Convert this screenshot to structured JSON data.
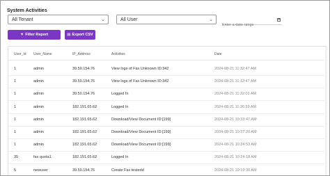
{
  "page": {
    "title": "System Activities"
  },
  "filters": {
    "tenant": "All Tenant",
    "user": "All User",
    "date_placeholder": "Enter a date range"
  },
  "buttons": {
    "filter_report": "Filter Report",
    "export_csv": "Export CSV"
  },
  "table": {
    "columns": [
      "User_Id",
      "User_Name",
      "IP_Address",
      "Activities",
      "Date"
    ],
    "rows": [
      [
        "1",
        "admin",
        "39.50.154.76",
        "View logs of Fax Unknown ID:342",
        "2024-08-21 11:32:47 AM"
      ],
      [
        "1",
        "admin",
        "39.50.154.76",
        "View logs of Fax Unknown ID:342",
        "2024-08-21 11:32:47 AM"
      ],
      [
        "1",
        "admin",
        "39.50.154.76",
        "Logged In",
        "2024-08-21 11:32:01 AM"
      ],
      [
        "1",
        "admin",
        "182.191.65.62",
        "Logged In",
        "2024-08-21 11:26:59 AM"
      ],
      [
        "1",
        "admin",
        "182.191.65.62",
        "Download/View Document ID:[199]",
        "2024-08-21 10:33:47 AM"
      ],
      [
        "1",
        "admin",
        "182.191.65.62",
        "Download/View Document ID:[199]",
        "2024-08-21 10:27:20 AM"
      ],
      [
        "1",
        "admin",
        "182.191.65.62",
        "Download/View Document ID:[199]",
        "2024-08-21 10:24:53 AM"
      ],
      [
        "35",
        "fax quota1",
        "182.191.65.62",
        "Logged In",
        "2024-08-21 10:24:18 AM"
      ],
      [
        "5",
        "newuser",
        "39.50.154.76",
        "Create Fax testedd",
        "2024-08-21 10:19:30 AM"
      ]
    ]
  }
}
